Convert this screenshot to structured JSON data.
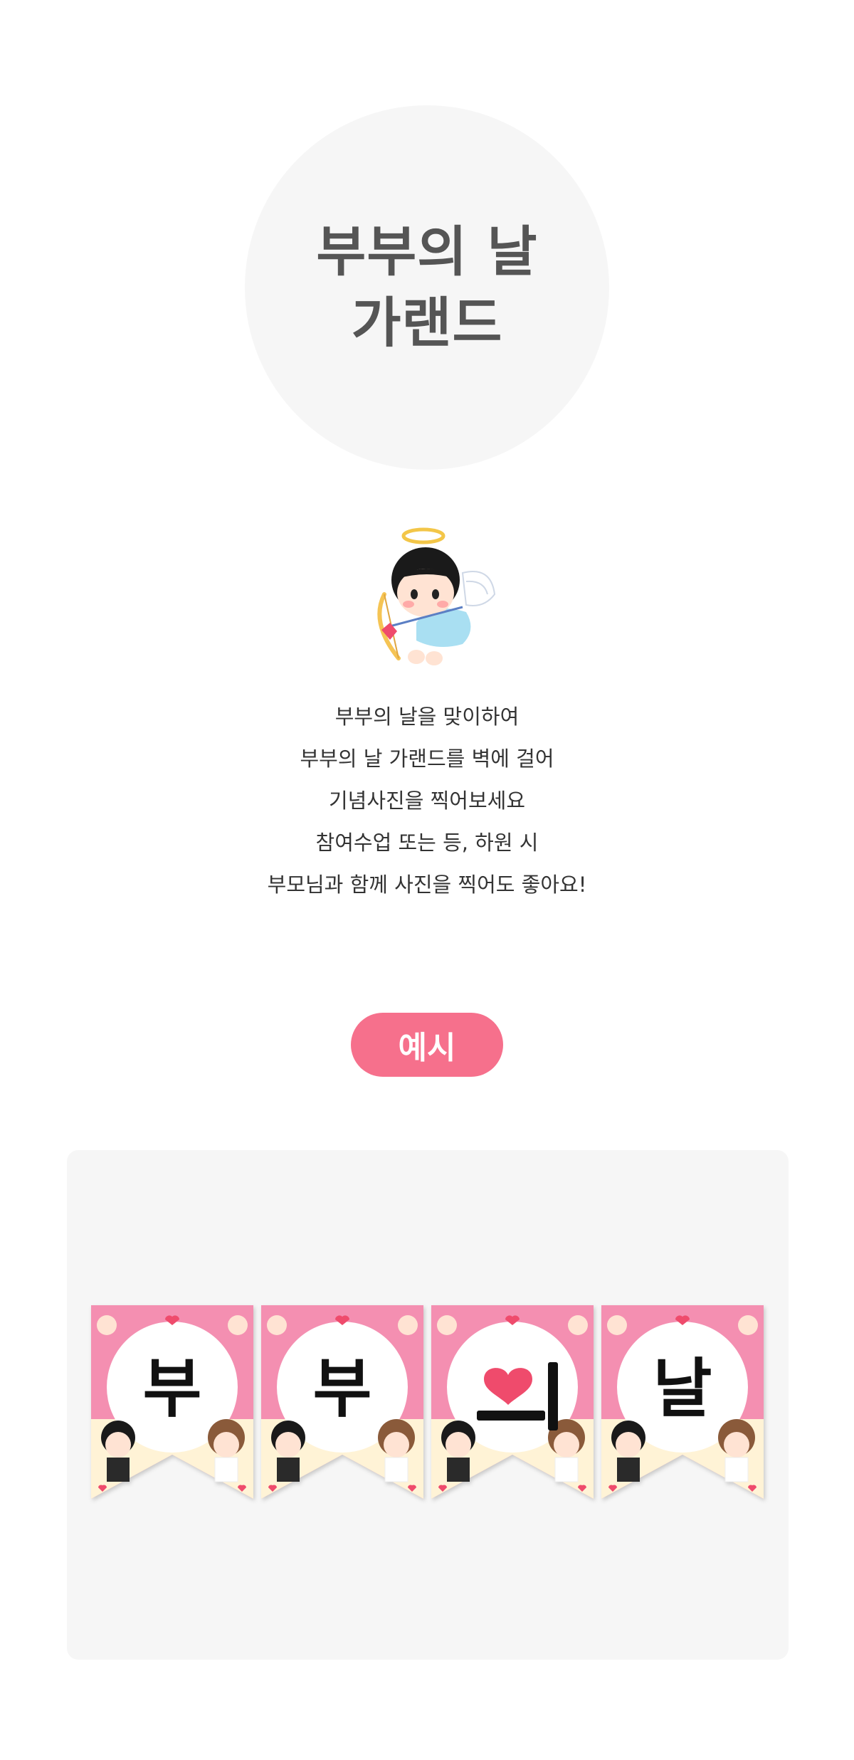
{
  "title": {
    "line1": "부부의 날",
    "line2": "가랜드"
  },
  "description": [
    "부부의 날을 맞이하여",
    "부부의 날 가랜드를 벽에 걸어",
    "기념사진을 찍어보세요",
    "참여수업 또는 등, 하원 시",
    "부모님과 함께 사진을 찍어도 좋아요!"
  ],
  "example_label": "예시",
  "garland": {
    "letters": [
      "부",
      "부",
      "",
      "날"
    ],
    "colors": {
      "pink": "#f48fb1",
      "cream": "#fff3d6",
      "accent": "#ef4b6c"
    }
  },
  "colors": {
    "pill": "#f6708c",
    "circle": "#f6f6f6",
    "box": "#f6f6f6"
  }
}
